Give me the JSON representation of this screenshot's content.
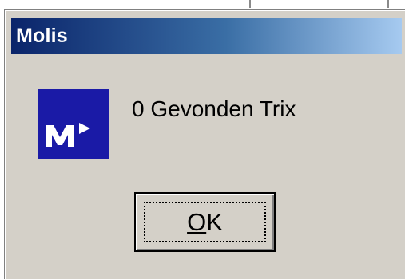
{
  "window": {
    "title": "Molis"
  },
  "dialog": {
    "message": "0 Gevonden Trix",
    "icon": "molis-logo-icon",
    "ok_button": {
      "mnemonic": "O",
      "rest": "K"
    }
  },
  "colors": {
    "titlebar_start": "#0a246a",
    "titlebar_end": "#a6caf0",
    "dialog_face": "#d4d0c8",
    "logo_background": "#1a1aa6"
  }
}
